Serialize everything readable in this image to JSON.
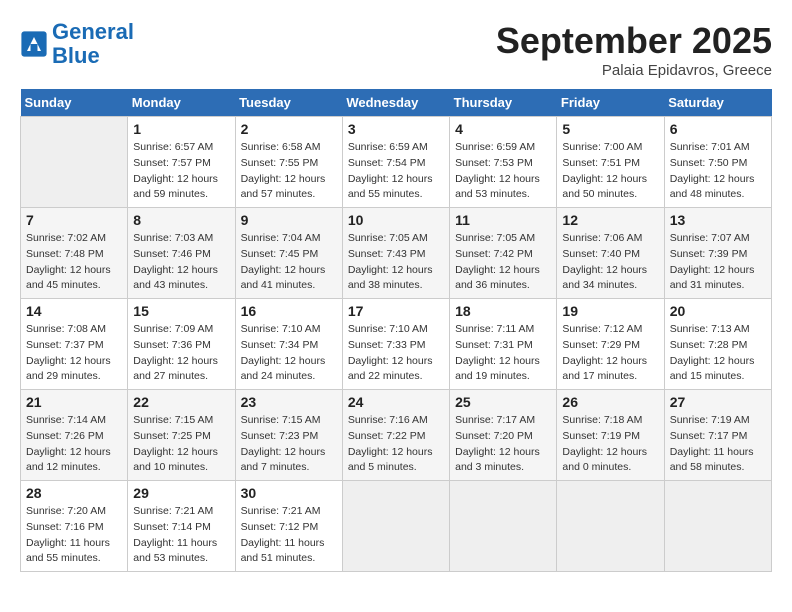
{
  "header": {
    "logo_line1": "General",
    "logo_line2": "Blue",
    "month": "September 2025",
    "location": "Palaia Epidavros, Greece"
  },
  "days_of_week": [
    "Sunday",
    "Monday",
    "Tuesday",
    "Wednesday",
    "Thursday",
    "Friday",
    "Saturday"
  ],
  "weeks": [
    [
      {
        "day": "",
        "info": ""
      },
      {
        "day": "1",
        "info": "Sunrise: 6:57 AM\nSunset: 7:57 PM\nDaylight: 12 hours\nand 59 minutes."
      },
      {
        "day": "2",
        "info": "Sunrise: 6:58 AM\nSunset: 7:55 PM\nDaylight: 12 hours\nand 57 minutes."
      },
      {
        "day": "3",
        "info": "Sunrise: 6:59 AM\nSunset: 7:54 PM\nDaylight: 12 hours\nand 55 minutes."
      },
      {
        "day": "4",
        "info": "Sunrise: 6:59 AM\nSunset: 7:53 PM\nDaylight: 12 hours\nand 53 minutes."
      },
      {
        "day": "5",
        "info": "Sunrise: 7:00 AM\nSunset: 7:51 PM\nDaylight: 12 hours\nand 50 minutes."
      },
      {
        "day": "6",
        "info": "Sunrise: 7:01 AM\nSunset: 7:50 PM\nDaylight: 12 hours\nand 48 minutes."
      }
    ],
    [
      {
        "day": "7",
        "info": "Sunrise: 7:02 AM\nSunset: 7:48 PM\nDaylight: 12 hours\nand 45 minutes."
      },
      {
        "day": "8",
        "info": "Sunrise: 7:03 AM\nSunset: 7:46 PM\nDaylight: 12 hours\nand 43 minutes."
      },
      {
        "day": "9",
        "info": "Sunrise: 7:04 AM\nSunset: 7:45 PM\nDaylight: 12 hours\nand 41 minutes."
      },
      {
        "day": "10",
        "info": "Sunrise: 7:05 AM\nSunset: 7:43 PM\nDaylight: 12 hours\nand 38 minutes."
      },
      {
        "day": "11",
        "info": "Sunrise: 7:05 AM\nSunset: 7:42 PM\nDaylight: 12 hours\nand 36 minutes."
      },
      {
        "day": "12",
        "info": "Sunrise: 7:06 AM\nSunset: 7:40 PM\nDaylight: 12 hours\nand 34 minutes."
      },
      {
        "day": "13",
        "info": "Sunrise: 7:07 AM\nSunset: 7:39 PM\nDaylight: 12 hours\nand 31 minutes."
      }
    ],
    [
      {
        "day": "14",
        "info": "Sunrise: 7:08 AM\nSunset: 7:37 PM\nDaylight: 12 hours\nand 29 minutes."
      },
      {
        "day": "15",
        "info": "Sunrise: 7:09 AM\nSunset: 7:36 PM\nDaylight: 12 hours\nand 27 minutes."
      },
      {
        "day": "16",
        "info": "Sunrise: 7:10 AM\nSunset: 7:34 PM\nDaylight: 12 hours\nand 24 minutes."
      },
      {
        "day": "17",
        "info": "Sunrise: 7:10 AM\nSunset: 7:33 PM\nDaylight: 12 hours\nand 22 minutes."
      },
      {
        "day": "18",
        "info": "Sunrise: 7:11 AM\nSunset: 7:31 PM\nDaylight: 12 hours\nand 19 minutes."
      },
      {
        "day": "19",
        "info": "Sunrise: 7:12 AM\nSunset: 7:29 PM\nDaylight: 12 hours\nand 17 minutes."
      },
      {
        "day": "20",
        "info": "Sunrise: 7:13 AM\nSunset: 7:28 PM\nDaylight: 12 hours\nand 15 minutes."
      }
    ],
    [
      {
        "day": "21",
        "info": "Sunrise: 7:14 AM\nSunset: 7:26 PM\nDaylight: 12 hours\nand 12 minutes."
      },
      {
        "day": "22",
        "info": "Sunrise: 7:15 AM\nSunset: 7:25 PM\nDaylight: 12 hours\nand 10 minutes."
      },
      {
        "day": "23",
        "info": "Sunrise: 7:15 AM\nSunset: 7:23 PM\nDaylight: 12 hours\nand 7 minutes."
      },
      {
        "day": "24",
        "info": "Sunrise: 7:16 AM\nSunset: 7:22 PM\nDaylight: 12 hours\nand 5 minutes."
      },
      {
        "day": "25",
        "info": "Sunrise: 7:17 AM\nSunset: 7:20 PM\nDaylight: 12 hours\nand 3 minutes."
      },
      {
        "day": "26",
        "info": "Sunrise: 7:18 AM\nSunset: 7:19 PM\nDaylight: 12 hours\nand 0 minutes."
      },
      {
        "day": "27",
        "info": "Sunrise: 7:19 AM\nSunset: 7:17 PM\nDaylight: 11 hours\nand 58 minutes."
      }
    ],
    [
      {
        "day": "28",
        "info": "Sunrise: 7:20 AM\nSunset: 7:16 PM\nDaylight: 11 hours\nand 55 minutes."
      },
      {
        "day": "29",
        "info": "Sunrise: 7:21 AM\nSunset: 7:14 PM\nDaylight: 11 hours\nand 53 minutes."
      },
      {
        "day": "30",
        "info": "Sunrise: 7:21 AM\nSunset: 7:12 PM\nDaylight: 11 hours\nand 51 minutes."
      },
      {
        "day": "",
        "info": ""
      },
      {
        "day": "",
        "info": ""
      },
      {
        "day": "",
        "info": ""
      },
      {
        "day": "",
        "info": ""
      }
    ]
  ]
}
